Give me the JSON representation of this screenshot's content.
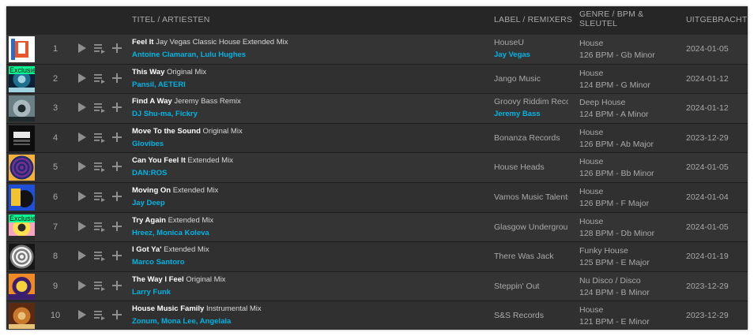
{
  "columns": {
    "title": "TITEL / ARTIESTEN",
    "label": "LABEL / REMIXERS",
    "genre": "GENRE / BPM & SLEUTEL",
    "date": "UITGEBRACHT"
  },
  "icons": {
    "play": "play-icon",
    "queue": "add-to-queue-icon",
    "add": "plus-icon"
  },
  "colors": {
    "accent": "#01b4e3",
    "exclusive": "#01ff95",
    "background": "#262626"
  },
  "tracks": [
    {
      "num": "1",
      "title": "Feel It",
      "mix": "Jay Vegas Classic House Extended Mix",
      "artists": "Antoine Clamaran, Lulu Hughes",
      "label": "HouseU",
      "remixer": "Jay Vegas",
      "genre": "House",
      "bpm_key": "126 BPM - Gb Minor",
      "date": "2024-01-05",
      "exclusive": ""
    },
    {
      "num": "2",
      "title": "This Way",
      "mix": "Original Mix",
      "artists": "Pansil, AETERI",
      "label": "Jango Music",
      "remixer": "",
      "genre": "House",
      "bpm_key": "124 BPM - G Minor",
      "date": "2024-01-12",
      "exclusive": "Exclusief"
    },
    {
      "num": "3",
      "title": "Find A Way",
      "mix": "Jeremy Bass Remix",
      "artists": "DJ Shu-ma, Fickry",
      "label": "Groovy Riddim Records",
      "remixer": "Jeremy Bass",
      "genre": "Deep House",
      "bpm_key": "124 BPM - A Minor",
      "date": "2024-01-12",
      "exclusive": ""
    },
    {
      "num": "4",
      "title": "Move To the Sound",
      "mix": "Original Mix",
      "artists": "Glovibes",
      "label": "Bonanza Records",
      "remixer": "",
      "genre": "House",
      "bpm_key": "126 BPM - Ab Major",
      "date": "2023-12-29",
      "exclusive": ""
    },
    {
      "num": "5",
      "title": "Can You Feel It",
      "mix": "Extended Mix",
      "artists": "DAN:ROS",
      "label": "House Heads",
      "remixer": "",
      "genre": "House",
      "bpm_key": "126 BPM - Bb Minor",
      "date": "2024-01-05",
      "exclusive": ""
    },
    {
      "num": "6",
      "title": "Moving On",
      "mix": "Extended Mix",
      "artists": "Jay Deep",
      "label": "Vamos Music Talents",
      "remixer": "",
      "genre": "House",
      "bpm_key": "126 BPM - F Major",
      "date": "2024-01-04",
      "exclusive": ""
    },
    {
      "num": "7",
      "title": "Try Again",
      "mix": "Extended Mix",
      "artists": "Hreez, Monica Koleva",
      "label": "Glasgow Underground",
      "remixer": "",
      "genre": "House",
      "bpm_key": "128 BPM - Db Minor",
      "date": "2024-01-05",
      "exclusive": "Exclusief"
    },
    {
      "num": "8",
      "title": "I Got Ya'",
      "mix": "Extended Mix",
      "artists": "Marco Santoro",
      "label": "There Was Jack",
      "remixer": "",
      "genre": "Funky House",
      "bpm_key": "125 BPM - E Major",
      "date": "2024-01-19",
      "exclusive": ""
    },
    {
      "num": "9",
      "title": "The Way I Feel",
      "mix": "Original Mix",
      "artists": "Larry Funk",
      "label": "Steppin' Out",
      "remixer": "",
      "genre": "Nu Disco / Disco",
      "bpm_key": "124 BPM - B Minor",
      "date": "2023-12-29",
      "exclusive": ""
    },
    {
      "num": "10",
      "title": "House Music Family",
      "mix": "Instrumental Mix",
      "artists": "Zonum, Mona Lee, Angelala",
      "label": "S&S Records",
      "remixer": "",
      "genre": "House",
      "bpm_key": "121 BPM - E Minor",
      "date": "2023-12-29",
      "exclusive": ""
    }
  ]
}
